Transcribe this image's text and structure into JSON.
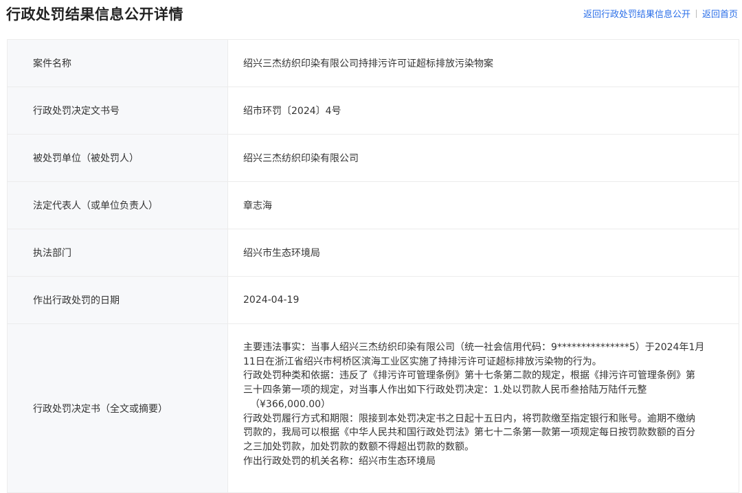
{
  "header": {
    "title": "行政处罚结果信息公开详情",
    "links": [
      "返回行政处罚结果信息公开",
      "返回首页"
    ]
  },
  "rows": [
    {
      "label": "案件名称",
      "value": "绍兴三杰纺织印染有限公司持排污许可证超标排放污染物案"
    },
    {
      "label": "行政处罚决定文书号",
      "value": "绍市环罚〔2024〕4号"
    },
    {
      "label": "被处罚单位（被处罚人）",
      "value": "绍兴三杰纺织印染有限公司"
    },
    {
      "label": "法定代表人（或单位负责人）",
      "value": "章志海"
    },
    {
      "label": "执法部门",
      "value": "绍兴市生态环境局"
    },
    {
      "label": "作出行政处罚的日期",
      "value": "2024-04-19"
    }
  ],
  "decision": {
    "label": "行政处罚决定书（全文或摘要）",
    "lines": [
      "主要违法事实：当事人绍兴三杰纺织印染有限公司（统一社会信用代码：9***************5）于2024年1月",
      "11日在浙江省绍兴市柯桥区滨海工业区实施了持排污许可证超标排放污染物的行为。",
      "行政处罚种类和依据：违反了《排污许可管理条例》第十七条第二款的规定，根据《排污许可管理条例》第",
      "三十四条第一项的规定，对当事人作出如下行政处罚决定：1.处以罚款人民币叁拾陆万陆仟元整",
      "（¥366,000.00）",
      "行政处罚履行方式和期限：限接到本处罚决定书之日起十五日内，将罚款缴至指定银行和账号。逾期不缴纳",
      "罚款的，我局可以根据《中华人民共和国行政处罚法》第七十二条第一款第一项规定每日按罚款数额的百分",
      "之三加处罚款，加处罚款的数额不得超出罚款的数额。",
      "作出行政处罚的机关名称：绍兴市生态环境局"
    ]
  }
}
